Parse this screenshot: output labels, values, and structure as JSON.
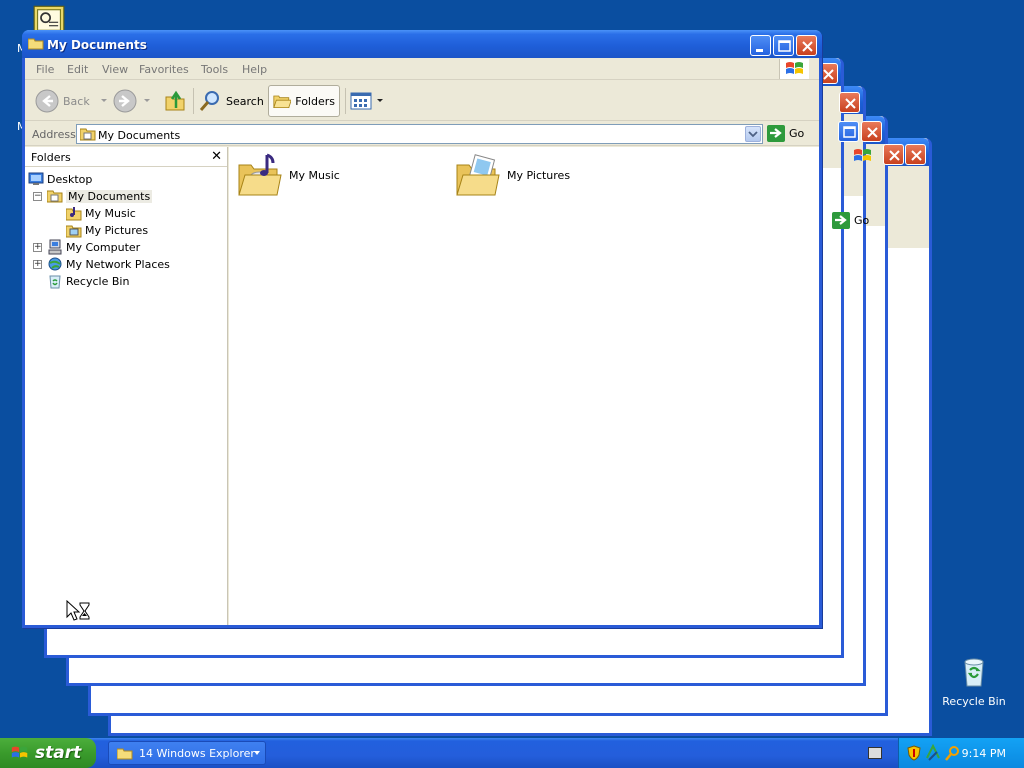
{
  "desktop": {
    "top_icon_label_fragment": "M",
    "recycle_bin_label": "Recycle Bin"
  },
  "window": {
    "title": "My Documents",
    "menu": [
      "File",
      "Edit",
      "View",
      "Favorites",
      "Tools",
      "Help"
    ],
    "toolbar": {
      "back_label": "Back",
      "search_label": "Search",
      "folders_label": "Folders"
    },
    "address": {
      "label": "Address",
      "value": "My Documents",
      "go_label": "Go"
    },
    "folders_pane": {
      "title": "Folders",
      "tree": [
        {
          "label": "Desktop",
          "icon": "desktop-icon"
        },
        {
          "label": "My Documents",
          "icon": "my-documents-icon",
          "selected": true,
          "expander": "−"
        },
        {
          "label": "My Music",
          "icon": "my-music-icon"
        },
        {
          "label": "My Pictures",
          "icon": "my-pictures-icon"
        },
        {
          "label": "My Computer",
          "icon": "my-computer-icon",
          "expander": "+"
        },
        {
          "label": "My Network Places",
          "icon": "network-places-icon",
          "expander": "+"
        },
        {
          "label": "Recycle Bin",
          "icon": "recycle-bin-icon"
        }
      ]
    },
    "content_items": [
      {
        "label": "My Music",
        "icon": "music-folder-icon"
      },
      {
        "label": "My Pictures",
        "icon": "pictures-folder-icon"
      }
    ]
  },
  "background_windows": {
    "go_label": "Go"
  },
  "taskbar": {
    "start_label": "start",
    "task_group_label": "14 Windows Explorer",
    "clock": "9:14 PM"
  }
}
